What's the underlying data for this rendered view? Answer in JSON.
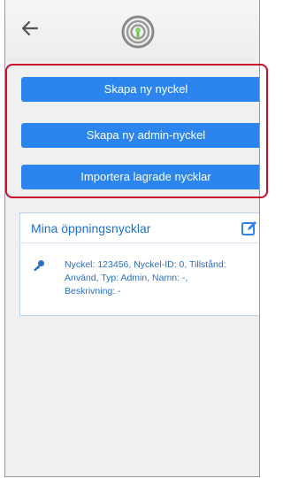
{
  "header": {
    "back_icon": "arrow-left-icon",
    "logo_icon": "fingerprint-logo-icon"
  },
  "actions": {
    "create_key": "Skapa ny nyckel",
    "create_admin_key": "Skapa ny admin-nyckel",
    "import_keys": "Importera lagrade nycklar"
  },
  "keys_card": {
    "title": "Mina öppningsnycklar",
    "edit_icon": "edit-icon",
    "items": [
      {
        "icon": "key-icon",
        "text": "Nyckel: 123456, Nyckel-ID: 0, Tillstånd: Använd, Typ: Admin, Namn: -, Beskrivning: -"
      }
    ]
  },
  "colors": {
    "accent": "#2c85ee",
    "highlight_border": "#c8102e",
    "link_text": "#2a6fc8",
    "background": "#f0f0f0"
  }
}
